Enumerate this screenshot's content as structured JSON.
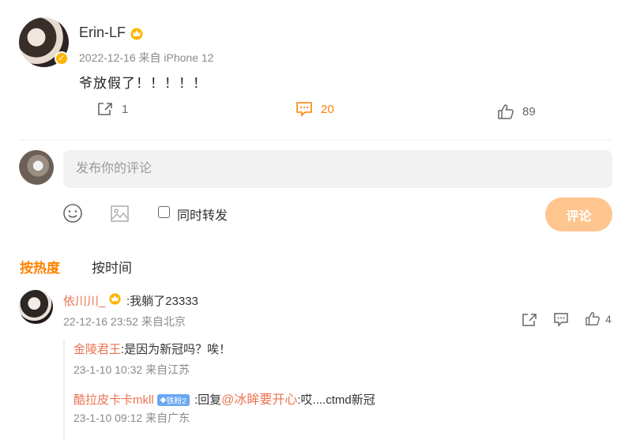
{
  "post": {
    "username": "Erin-LF",
    "date": "2022-12-16",
    "source": "来自 iPhone 12",
    "text": "爷放假了！！！！！",
    "share_count": "1",
    "comment_count": "20",
    "like_count": "89"
  },
  "composer": {
    "placeholder": "发布你的评论",
    "repost_label": "同时转发",
    "submit_label": "评论"
  },
  "sort_tabs": [
    "按热度",
    "按时间"
  ],
  "comment": {
    "username": "依川川_",
    "text": ":我躺了23333",
    "meta": "22-12-16 23:52 来自北京",
    "like_count": "4"
  },
  "replies": [
    {
      "username": "金陵君王",
      "text": ":是因为新冠吗？唉！",
      "meta": "23-1-10 10:32 来自江苏"
    },
    {
      "username": "酷拉皮卡卡mkll",
      "badge": "铁粉2",
      "text_prefix": ":回复",
      "mention": "@冰眸要开心",
      "text_suffix": ":哎....ctmd新冠",
      "meta": "23-1-10 09:12 来自广东"
    }
  ],
  "colors": {
    "accent": "#ff8200",
    "username": "#eb7350",
    "submit_disabled": "#ffc58f",
    "fan_badge": "#6aa7f2"
  }
}
